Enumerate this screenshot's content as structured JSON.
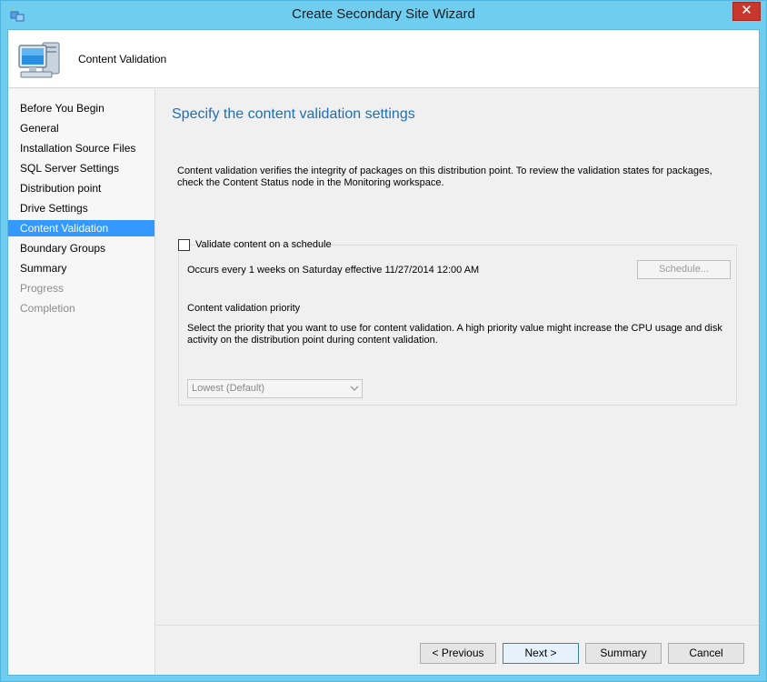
{
  "window": {
    "title": "Create Secondary Site Wizard",
    "close_glyph": "✕"
  },
  "header": {
    "title": "Content Validation",
    "icon": "computer-icon"
  },
  "sidebar": {
    "items": [
      {
        "label": "Before You Begin",
        "state": "normal"
      },
      {
        "label": "General",
        "state": "normal"
      },
      {
        "label": "Installation Source Files",
        "state": "normal"
      },
      {
        "label": "SQL Server Settings",
        "state": "normal"
      },
      {
        "label": "Distribution point",
        "state": "normal"
      },
      {
        "label": "Drive Settings",
        "state": "normal"
      },
      {
        "label": "Content Validation",
        "state": "active"
      },
      {
        "label": "Boundary Groups",
        "state": "normal"
      },
      {
        "label": "Summary",
        "state": "normal"
      },
      {
        "label": "Progress",
        "state": "disabled"
      },
      {
        "label": "Completion",
        "state": "disabled"
      }
    ]
  },
  "main": {
    "heading": "Specify the content validation settings",
    "description": "Content validation verifies the integrity of packages on this distribution point. To review the validation states for packages, check the Content Status node in the Monitoring workspace.",
    "validate_checkbox": {
      "label": "Validate content on a schedule",
      "checked": false
    },
    "occurs_text": "Occurs every 1 weeks on Saturday effective 11/27/2014 12:00 AM",
    "schedule_button": "Schedule...",
    "priority_title": "Content validation priority",
    "priority_description": "Select the priority that you want to use for content validation. A high priority value might increase the CPU usage and disk activity on the distribution point during content validation.",
    "priority_select": {
      "value": "Lowest (Default)",
      "enabled": false
    }
  },
  "footer": {
    "previous": "< Previous",
    "next": "Next >",
    "summary": "Summary",
    "cancel": "Cancel"
  },
  "colors": {
    "frame": "#6fcdf0",
    "active_nav": "#3399ff",
    "heading": "#1f6fb3",
    "close": "#c7372b"
  }
}
